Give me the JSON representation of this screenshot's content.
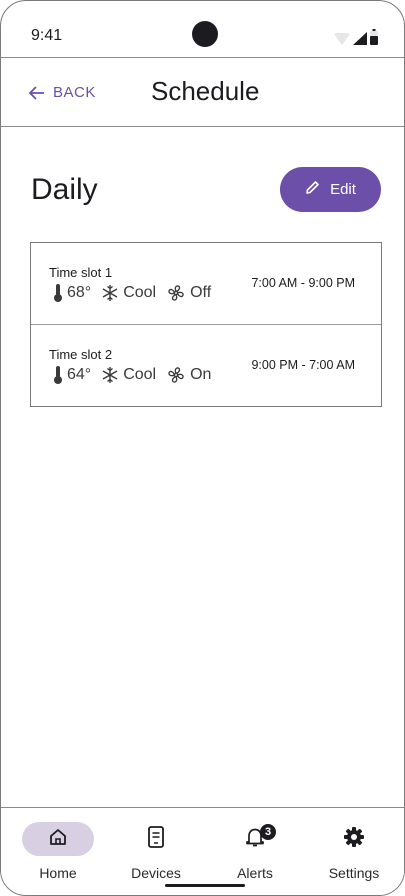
{
  "status_bar": {
    "time": "9:41"
  },
  "header": {
    "back_label": "BACK",
    "title": "Schedule"
  },
  "section": {
    "title": "Daily",
    "edit_label": "Edit"
  },
  "slots": [
    {
      "name": "Time slot 1",
      "temperature": "68°",
      "mode": "Cool",
      "fan": "Off",
      "time_range": "7:00 AM - 9:00 PM"
    },
    {
      "name": "Time slot 2",
      "temperature": "64°",
      "mode": "Cool",
      "fan": "On",
      "time_range": "9:00 PM - 7:00 AM"
    }
  ],
  "nav": {
    "items": [
      {
        "label": "Home",
        "icon": "home-icon",
        "active": true
      },
      {
        "label": "Devices",
        "icon": "device-icon",
        "active": false
      },
      {
        "label": "Alerts",
        "icon": "bell-icon",
        "active": false,
        "badge": "3"
      },
      {
        "label": "Settings",
        "icon": "gear-icon",
        "active": false
      }
    ]
  },
  "colors": {
    "accent": "#6b4fa8",
    "active_nav_bg": "#d8cfe3",
    "text": "#1c1b1f"
  }
}
